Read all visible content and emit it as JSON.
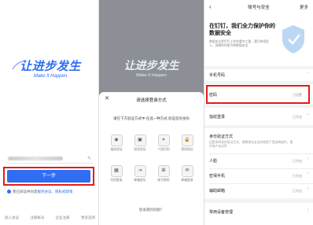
{
  "login": {
    "brand_name": "让进步发生",
    "brand_slogan": "Make It Happen",
    "next_label": "下一步",
    "agree_prefix": "我已阅读并同意",
    "agree_service": "服务协议",
    "agree_sep": "、",
    "agree_privacy": "隐私权政策",
    "bottom_links": [
      "加入会议",
      "注册账号",
      "企业注册",
      "更多选项"
    ]
  },
  "picker": {
    "brand_name": "让进步发生",
    "brand_slogan": "Make It Happen",
    "sheet_title": "请选择登录方式",
    "hint": "请在下方验证方式中 任选一种方式 验证您的身份",
    "options": [
      {
        "label": "指纹验证",
        "icon": "fingerprint-icon",
        "glyph": "◉"
      },
      {
        "label": "短信验证",
        "icon": "sms-icon",
        "glyph": "▣"
      },
      {
        "label": "人脸识别",
        "icon": "face-scan-icon",
        "glyph": "⌗"
      },
      {
        "label": "密码验证",
        "icon": "lock-icon",
        "glyph": "🔒"
      },
      {
        "label": "扫码登录",
        "icon": "qr-icon",
        "glyph": "▦"
      },
      {
        "label": "邮箱验证",
        "icon": "exit-icon",
        "glyph": "⇥"
      },
      {
        "label": "账号密码",
        "icon": "key-icon",
        "glyph": "⌘"
      },
      {
        "label": "邮箱登录",
        "icon": "mail-icon",
        "glyph": "✉"
      }
    ],
    "footer": "登录遇到问题？"
  },
  "security": {
    "title": "账号与安全",
    "more": "更多",
    "banner_title": "在钉钉，我们全力保护你的数据安全",
    "banner_sub": "数据安全是钉钉工作的重中之重，我们持续投入，保障你的账号和数据安全",
    "rows": [
      {
        "label": "手机号码",
        "value": ""
      },
      {
        "label": "密码",
        "value": "已设置"
      },
      {
        "label": "指纹登录",
        "value": "已开启"
      },
      {
        "label": "身份验证方式",
        "value": "",
        "desc": "设置多种身份验证方式，保障你在安全的前提下登录和操作，提升账户安全性"
      },
      {
        "label": "人脸",
        "value": "已开启"
      },
      {
        "label": "密保手机",
        "value": "已开启"
      },
      {
        "label": "辅助邮箱",
        "value": "已开启"
      },
      {
        "label": "常用设备管理",
        "value": ""
      }
    ]
  },
  "colors": {
    "accent": "#2f6df2",
    "highlight": "#e21b1b"
  }
}
